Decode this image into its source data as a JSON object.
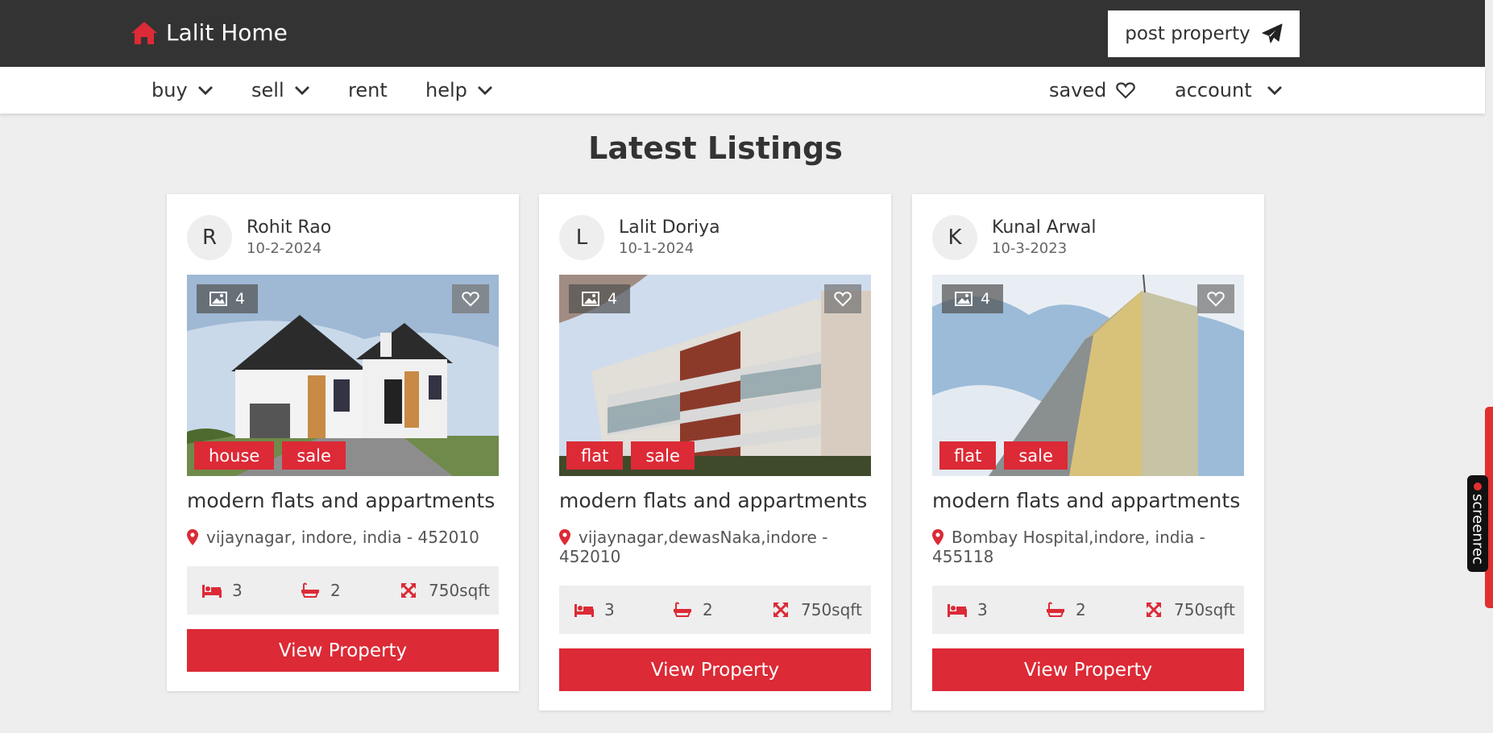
{
  "brand": {
    "name": "Lalit Home",
    "color": "#dc2a36"
  },
  "header": {
    "post_label": "post property"
  },
  "nav": {
    "buy": "buy",
    "sell": "sell",
    "rent": "rent",
    "help": "help",
    "saved": "saved",
    "account": "account"
  },
  "section_title": "Latest Listings",
  "listings": [
    {
      "initial": "R",
      "owner": "Rohit Rao",
      "date": "10-2-2024",
      "image_count": "4",
      "tags": [
        "house",
        "sale"
      ],
      "title": "modern flats and appartments",
      "address": "vijaynagar, indore, india - 452010",
      "beds": "3",
      "baths": "2",
      "area": "750sqft",
      "button": "View Property"
    },
    {
      "initial": "L",
      "owner": "Lalit Doriya",
      "date": "10-1-2024",
      "image_count": "4",
      "tags": [
        "flat",
        "sale"
      ],
      "title": "modern flats and appartments",
      "address": "vijaynagar,dewasNaka,indore - 452010",
      "beds": "3",
      "baths": "2",
      "area": "750sqft",
      "button": "View Property"
    },
    {
      "initial": "K",
      "owner": "Kunal Arwal",
      "date": "10-3-2023",
      "image_count": "4",
      "tags": [
        "flat",
        "sale"
      ],
      "title": "modern flats and appartments",
      "address": "Bombay Hospital,indore, india - 455118",
      "beds": "3",
      "baths": "2",
      "area": "750sqft",
      "button": "View Property"
    }
  ],
  "overlay": {
    "recorder_label": "screenrec"
  }
}
